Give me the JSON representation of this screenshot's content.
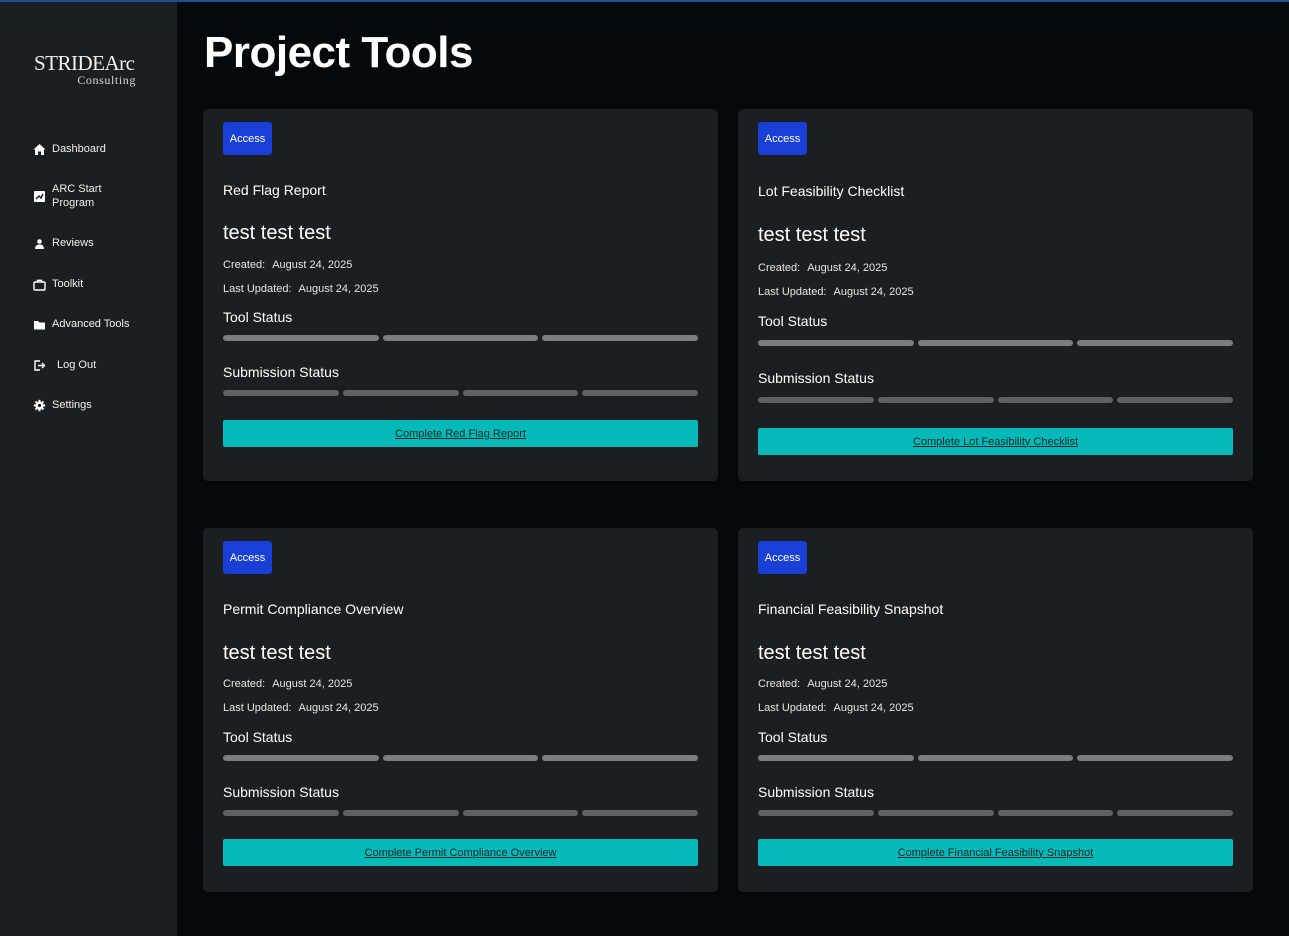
{
  "brand": {
    "name": "STRIDEArc",
    "sub": "Consulting"
  },
  "sidebar": {
    "items": [
      {
        "label": "Dashboard",
        "icon": "home-icon"
      },
      {
        "label": "ARC Start Program",
        "icon": "program-icon"
      },
      {
        "label": "Reviews",
        "icon": "person-icon"
      },
      {
        "label": "Toolkit",
        "icon": "briefcase-icon"
      },
      {
        "label": "Advanced Tools",
        "icon": "folder-icon"
      },
      {
        "label": "Log Out",
        "icon": "logout-icon"
      },
      {
        "label": "Settings",
        "icon": "gear-icon"
      }
    ]
  },
  "page": {
    "title": "Project Tools"
  },
  "labels": {
    "access": "Access",
    "created": "Created:",
    "last_updated": "Last Updated:",
    "tool_status": "Tool Status",
    "submission_status": "Submission Status"
  },
  "cards": [
    {
      "tool": "Red Flag Report",
      "project": "test test test",
      "created": "August 24, 2025",
      "updated": "August 24, 2025",
      "cta": "Complete Red Flag Report"
    },
    {
      "tool": "Lot Feasibility Checklist",
      "project": "test test test",
      "created": "August 24, 2025",
      "updated": "August 24, 2025",
      "cta": "Complete Lot Feasibility Checklist"
    },
    {
      "tool": "Permit Compliance Overview",
      "project": "test test test",
      "created": "August 24, 2025",
      "updated": "August 24, 2025",
      "cta": "Complete Permit Compliance Overview"
    },
    {
      "tool": "Financial Feasibility Snapshot",
      "project": "test test test",
      "created": "August 24, 2025",
      "updated": "August 24, 2025",
      "cta": "Complete Financial Feasibility Snapshot"
    }
  ],
  "colors": {
    "background": "#05090c",
    "sidebar": "#1c1f21",
    "card": "#1c1f21",
    "access_badge": "#1a3fd6",
    "cta_button": "#05b9b9",
    "tool_status_bar": "#7b7d7f",
    "submission_status_bar": "#5f6264"
  }
}
